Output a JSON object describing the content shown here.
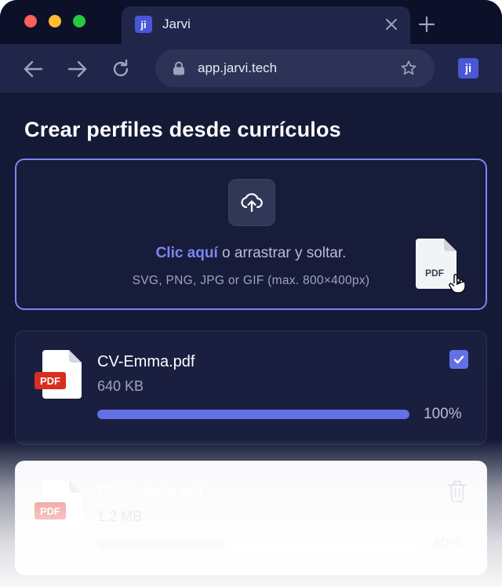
{
  "browser": {
    "tab_title": "Jarvi",
    "favicon_text": "ji",
    "url": "app.jarvi.tech",
    "extension_text": "ji"
  },
  "page": {
    "title": "Crear perfiles desde currículos"
  },
  "dropzone": {
    "link_text": "Clic aquí",
    "main_text": " o arrastrar y soltar.",
    "sub_text": "SVG, PNG, JPG or GIF (max. 800×400px)",
    "drag_file_label": "PDF"
  },
  "files": [
    {
      "name": "CV-Emma.pdf",
      "size": "640 KB",
      "badge": "PDF",
      "progress": 100,
      "progress_label": "100%",
      "status": "complete"
    },
    {
      "name": "CV-Antonio.pdf",
      "size": "1.2 MB",
      "badge": "PDF",
      "progress": 40,
      "progress_label": "40%",
      "status": "uploading"
    }
  ],
  "colors": {
    "accent": "#6370e6",
    "link": "#7c86f0",
    "pdf_badge": "#d92d20",
    "background": "#151a37"
  }
}
